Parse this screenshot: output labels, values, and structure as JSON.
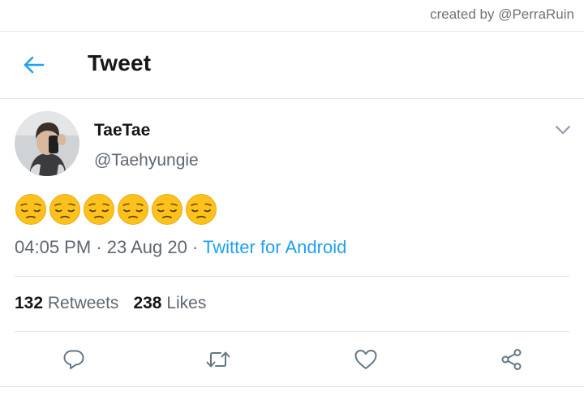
{
  "watermark": "created by @PerraRuin",
  "header": {
    "title": "Tweet",
    "back_icon": "arrow-left-icon"
  },
  "tweet": {
    "display_name": "TaeTae",
    "handle": "@Taehyungie",
    "text": "😔😔😔😔😔😔",
    "emoji_count": 6,
    "time": "04:05 PM",
    "date": "23 Aug 20",
    "separator": "·",
    "source": "Twitter for Android"
  },
  "stats": {
    "retweets_count": "132",
    "retweets_label": "Retweets",
    "likes_count": "238",
    "likes_label": "Likes"
  },
  "actions": [
    "reply-icon",
    "retweet-icon",
    "like-icon",
    "share-icon"
  ],
  "colors": {
    "accent": "#1da1f2",
    "secondary_text": "#5f6770",
    "divider": "#e1e5e9",
    "icon": "#657786"
  }
}
